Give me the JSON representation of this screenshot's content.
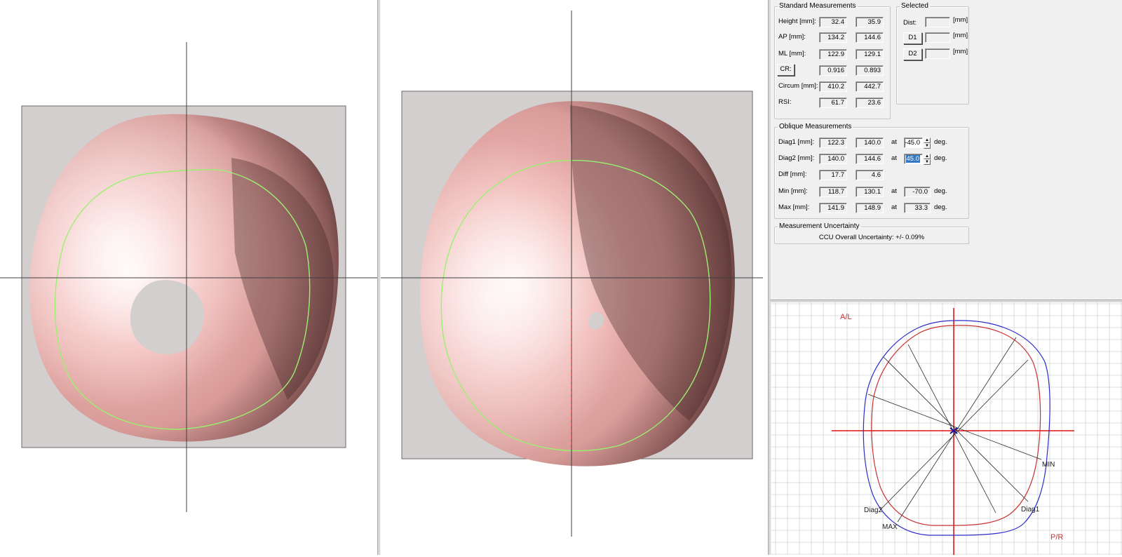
{
  "standard": {
    "title": "Standard Measurements",
    "rows": [
      {
        "label": "Height  [mm]:",
        "v1": "32.4",
        "v2": "35.9"
      },
      {
        "label": "AP  [mm]:",
        "v1": "134.2",
        "v2": "144.6"
      },
      {
        "label": "ML  [mm]:",
        "v1": "122.9",
        "v2": "129.1"
      },
      {
        "label": "CR:",
        "v1": "0.916",
        "v2": "0.893"
      },
      {
        "label": "Circum  [mm]:",
        "v1": "410.2",
        "v2": "442.7"
      },
      {
        "label": "RSI:",
        "v1": "61.7",
        "v2": "23.6"
      }
    ]
  },
  "selected": {
    "title": "Selected",
    "dist_label": "Dist:",
    "d1_label": "D1",
    "d2_label": "D2",
    "unit": "[mm]"
  },
  "oblique": {
    "title": "Oblique Measurements",
    "at": "at",
    "deg": "deg.",
    "rows": [
      {
        "label": "Diag1  [mm]:",
        "v1": "122.3",
        "v2": "140.0",
        "angle": "-45.0"
      },
      {
        "label": "Diag2  [mm]:",
        "v1": "140.0",
        "v2": "144.6",
        "angle": "45.0"
      },
      {
        "label": "Diff  [mm]:",
        "v1": "17.7",
        "v2": "4.6"
      },
      {
        "label": "Min  [mm]:",
        "v1": "118.7",
        "v2": "130.1",
        "angle": "-70.0"
      },
      {
        "label": "Max  [mm]:",
        "v1": "141.9",
        "v2": "148.9",
        "angle": "33.3"
      }
    ]
  },
  "uncertainty": {
    "title": "Measurement Uncertainty",
    "text": "CCU Overall Uncertainty: +/- 0.09%"
  },
  "plot": {
    "al": "A/L",
    "pr": "P/R",
    "min": "MIN",
    "max": "MAX",
    "diag1": "Diag1",
    "diag2": "Diag2",
    "colors": {
      "outer": "#2c2cc8",
      "inner": "#c83232",
      "axis": "#e01010",
      "grid": "#d4d4d4"
    }
  },
  "colors": {
    "surface": "#e8a3a0",
    "contour": "#9cf070",
    "backdrop": "#d3cfcf"
  }
}
